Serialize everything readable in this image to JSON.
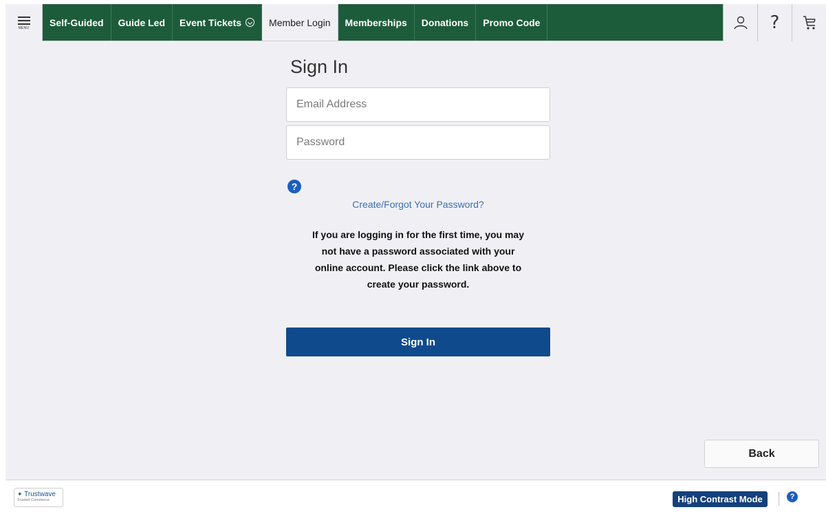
{
  "nav": {
    "menu_label": "MENU",
    "tabs": [
      {
        "label": "Self-Guided"
      },
      {
        "label": "Guide Led"
      },
      {
        "label": "Event Tickets"
      },
      {
        "label": "Member Login"
      },
      {
        "label": "Memberships"
      },
      {
        "label": "Donations"
      },
      {
        "label": "Promo Code"
      }
    ],
    "active_tab": "Member Login",
    "right_icons": [
      "user-icon",
      "help-icon",
      "cart-icon"
    ],
    "help_glyph": "?"
  },
  "signin": {
    "title": "Sign In",
    "email_placeholder": "Email Address",
    "email_value": "",
    "password_placeholder": "Password",
    "password_value": "",
    "help_glyph": "?",
    "forgot_link": "Create/Forgot Your Password?",
    "notice": "If you are logging in for the first time, you may not have a password associated with your online account. Please click the link above to create your password.",
    "button_label": "Sign In"
  },
  "back_label": "Back",
  "footer": {
    "badge_title": "Trustwave",
    "badge_subtitle": "Trusted Commerce",
    "high_contrast_label": "High Contrast Mode",
    "help_glyph": "?"
  },
  "colors": {
    "nav_green": "#1d5c3b",
    "primary_blue": "#0f4a8c",
    "link_blue": "#3a6fb5",
    "background": "#f0f0f4"
  }
}
